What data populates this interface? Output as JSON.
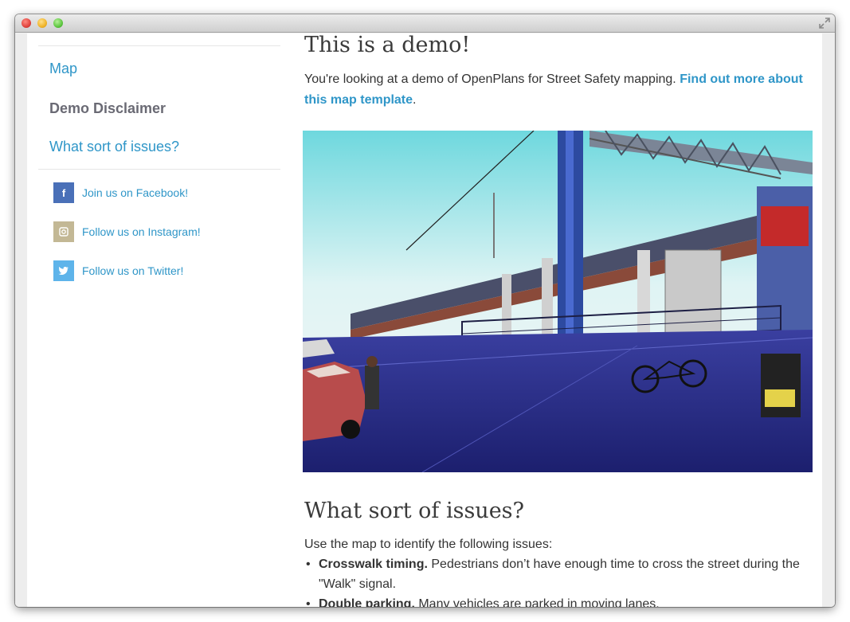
{
  "sidebar": {
    "nav": [
      {
        "label": "Map"
      },
      {
        "label": "Demo Disclaimer"
      },
      {
        "label": "What sort of issues?"
      }
    ],
    "social": [
      {
        "label": "Join us on Facebook!",
        "icon": "facebook-icon",
        "glyph": "f",
        "color": "#4a70b8"
      },
      {
        "label": "Follow us on Instagram!",
        "icon": "instagram-icon",
        "glyph": "▢",
        "color": "#c3b895"
      },
      {
        "label": "Follow us on Twitter!",
        "icon": "twitter-icon",
        "glyph": "🐦",
        "color": "#5eb4ea"
      }
    ]
  },
  "main": {
    "title": "This is a demo!",
    "intro": {
      "text": "You're looking at a demo of OpenPlans for Street Safety mapping. ",
      "link": "Find out more about this map template",
      "after": "."
    },
    "issues": {
      "heading": "What sort of issues?",
      "lead": "Use the map to identify the following issues:",
      "items": [
        {
          "term": "Crosswalk timing.",
          "text": " Pedestrians don’t have enough time to cross the street during the \"Walk\" signal."
        },
        {
          "term": "Double parking.",
          "text": " Many vehicles are parked in moving lanes."
        }
      ]
    }
  },
  "colors": {
    "link": "#2f96c8",
    "active_nav": "#6a6a74",
    "heading": "#3a3a3a"
  }
}
